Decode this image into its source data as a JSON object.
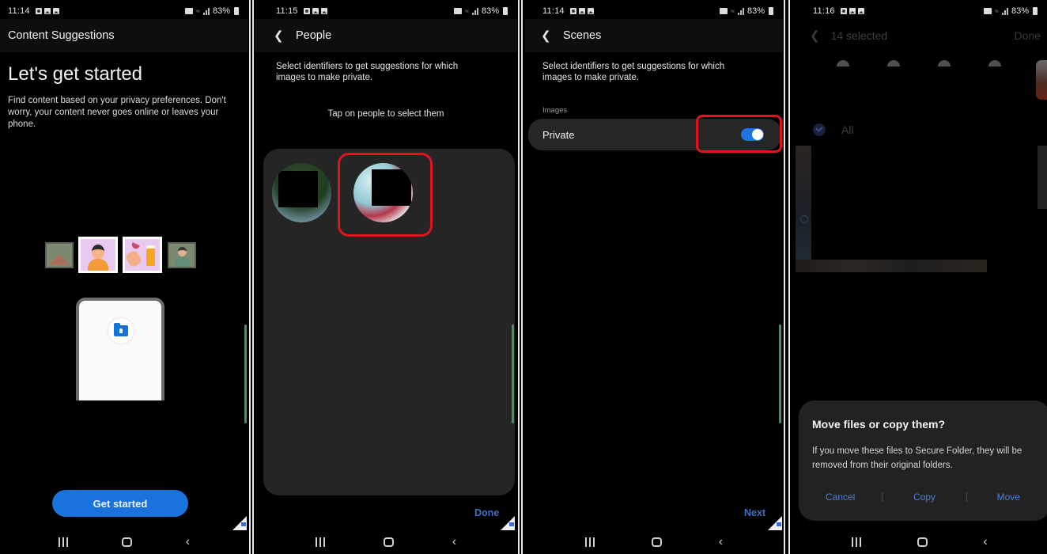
{
  "screens": [
    {
      "status": {
        "time": "11:14",
        "battery": "83%"
      },
      "appbar_title": "Content Suggestions",
      "heading": "Let's get started",
      "description": "Find content based on your privacy preferences. Don't worry, your content never goes online or leaves your phone.",
      "primary_button": "Get started"
    },
    {
      "status": {
        "time": "11:15",
        "battery": "83%"
      },
      "appbar_title": "People",
      "intro": "Select identifiers to get suggestions for which images to make private.",
      "hint": "Tap on people to select them",
      "people": [
        {
          "name": "person-1",
          "selected": false
        },
        {
          "name": "person-2",
          "selected": true
        }
      ],
      "action_button": "Done"
    },
    {
      "status": {
        "time": "11:14",
        "battery": "83%"
      },
      "appbar_title": "Scenes",
      "intro": "Select identifiers to get suggestions for which images to make private.",
      "section_label": "Images",
      "toggle_row": {
        "label": "Private",
        "on": true
      },
      "action_button": "Next"
    },
    {
      "status": {
        "time": "11:16",
        "battery": "83%"
      },
      "appbar_title": "14 selected",
      "appbar_action": "Done",
      "select_all_label": "All",
      "dialog": {
        "title": "Move files or copy them?",
        "body": "If you move these files to Secure Folder, they will be removed from their original folders.",
        "actions": [
          "Cancel",
          "Copy",
          "Move"
        ]
      }
    }
  ],
  "colors": {
    "accent_blue": "#1a73dc",
    "highlight_red": "#e0141e",
    "scrollbar_green": "#3f9461"
  }
}
